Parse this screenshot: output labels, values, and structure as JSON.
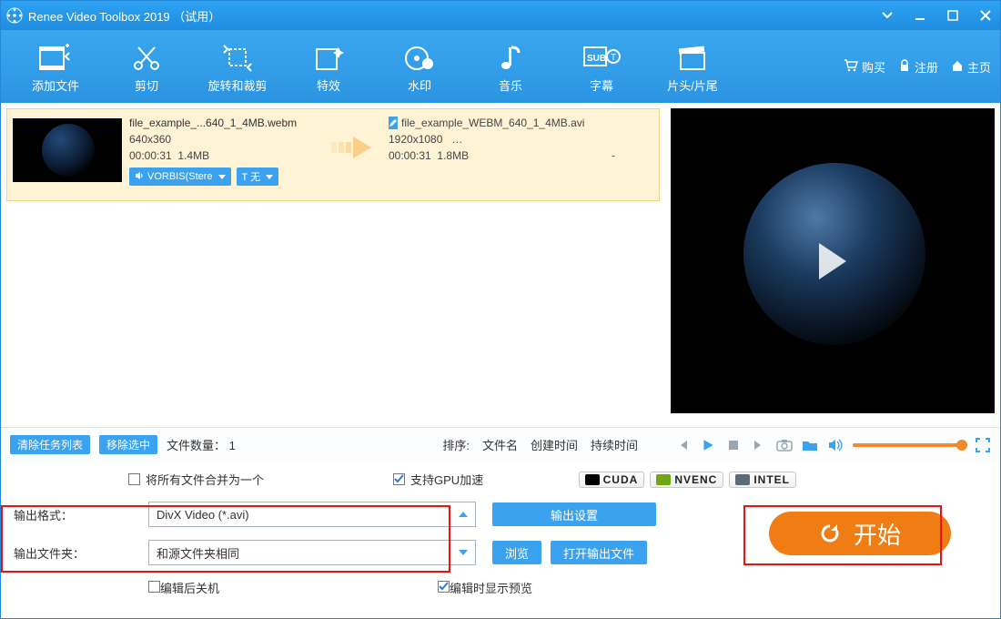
{
  "title": "Renee Video Toolbox 2019 （试用）",
  "toolbar": {
    "items": [
      {
        "label": "添加文件",
        "icon": "film-add"
      },
      {
        "label": "剪切",
        "icon": "scissors"
      },
      {
        "label": "旋转和裁剪",
        "icon": "crop-rotate"
      },
      {
        "label": "特效",
        "icon": "sparkle-film"
      },
      {
        "label": "水印",
        "icon": "watermark"
      },
      {
        "label": "音乐",
        "icon": "music-note"
      },
      {
        "label": "字幕",
        "icon": "subtitle"
      },
      {
        "label": "片头/片尾",
        "icon": "slate"
      }
    ]
  },
  "header_right": {
    "buy": "购买",
    "register": "注册",
    "home": "主页"
  },
  "task": {
    "src": {
      "filename": "file_example_...640_1_4MB.webm",
      "resolution": "640x360",
      "duration": "00:00:31",
      "size": "1.4MB",
      "audio_pill": "VORBIS(Stere",
      "text_pill": "T  无"
    },
    "dst": {
      "filename": "file_example_WEBM_640_1_4MB.avi",
      "resolution": "1920x1080",
      "res_suffix": "…",
      "duration": "00:00:31",
      "size": "1.8MB"
    },
    "dash": "-"
  },
  "midbar": {
    "clear": "清除任务列表",
    "remove": "移除选中",
    "count_label": "文件数量：",
    "count_value": "1",
    "sort_label": "排序:",
    "sort_cols": [
      "文件名",
      "创建时间",
      "持续时间"
    ]
  },
  "bottom": {
    "merge_label": "将所有文件合并为一个",
    "gpu_label": "支持GPU加速",
    "gpu_chips": [
      "CUDA",
      "NVENC",
      "INTEL"
    ],
    "fmt_label": "输出格式：",
    "fmt_value": "DivX Video (*.avi)",
    "out_settings": "输出设置",
    "folder_label": "输出文件夹：",
    "folder_value": "和源文件夹相同",
    "browse": "浏览",
    "open_folder": "打开输出文件",
    "shutdown": "编辑后关机",
    "preview_on_edit": "编辑时显示预览",
    "start": "开始"
  }
}
